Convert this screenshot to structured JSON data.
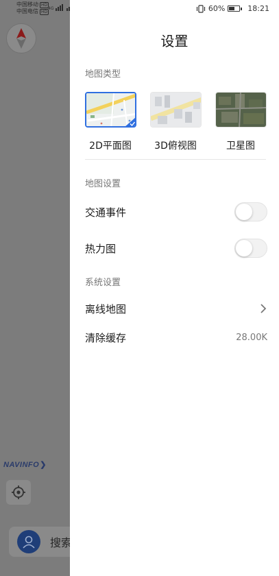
{
  "status": {
    "carrier1": "中国移动",
    "carrier2": "中国电信",
    "hd_badge": "HD",
    "net_tag": "4G",
    "battery_pct": "60%",
    "battery_level": 0.6,
    "time": "18:21"
  },
  "background": {
    "brand": "NAVINFO",
    "search_placeholder": "搜索"
  },
  "settings": {
    "title": "设置",
    "map_type_section": "地图类型",
    "map_types": [
      {
        "label": "2D平面图",
        "selected": true
      },
      {
        "label": "3D俯视图",
        "selected": false
      },
      {
        "label": "卫星图",
        "selected": false
      }
    ],
    "map_settings_section": "地图设置",
    "traffic_events_label": "交通事件",
    "traffic_events_on": false,
    "heatmap_label": "热力图",
    "heatmap_on": false,
    "system_section": "系统设置",
    "offline_map_label": "离线地图",
    "clear_cache_label": "清除缓存",
    "cache_size": "28.00K"
  },
  "colors": {
    "accent": "#2f6fe0",
    "overlay": "#7c7c7c",
    "panel": "#ffffff"
  },
  "icons": [
    "compass-icon",
    "locate-icon",
    "avatar-icon",
    "wifi-icon",
    "vibrate-icon",
    "battery-icon",
    "chevron-right-icon",
    "check-icon"
  ]
}
